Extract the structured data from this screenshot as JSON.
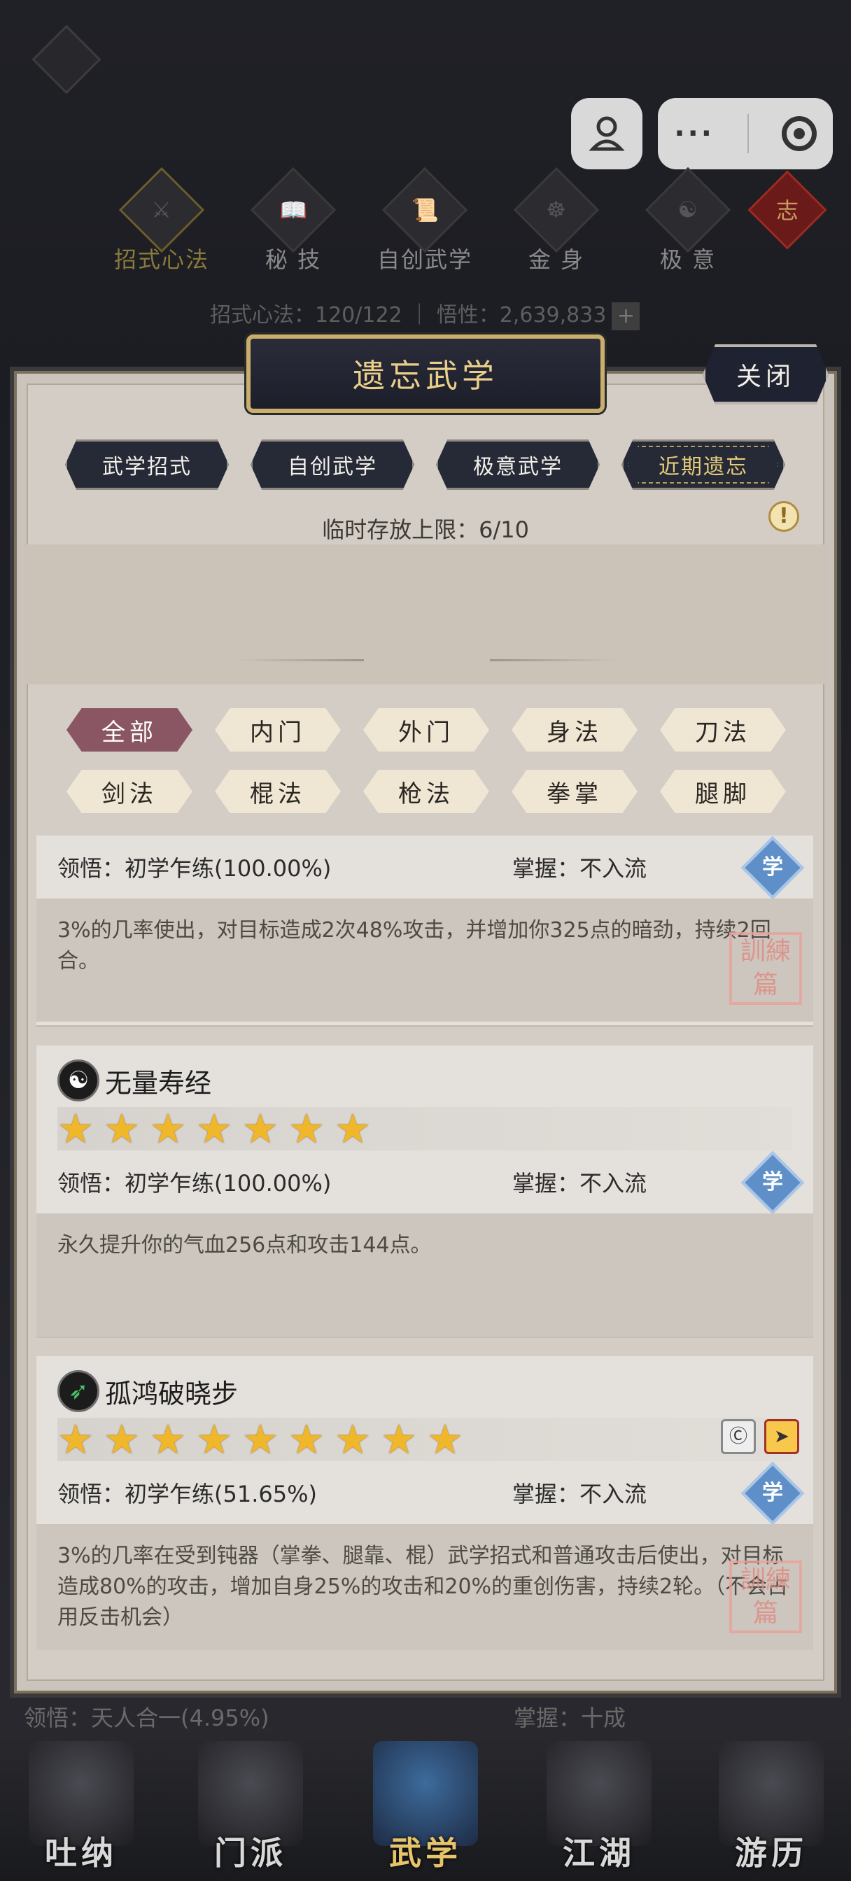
{
  "capsule": {
    "more_label": "···"
  },
  "topnav": {
    "items": [
      {
        "label": "招式心法",
        "icon": "sword-icon"
      },
      {
        "label": "秘 技",
        "icon": "book-icon"
      },
      {
        "label": "自创武学",
        "icon": "scroll-icon"
      },
      {
        "label": "金 身",
        "icon": "meditation-icon"
      },
      {
        "label": "极 意",
        "icon": "martial-pose-icon"
      }
    ],
    "knot_label": "志",
    "stats": "招式心法：120/122 ｜ 悟性：2,639,833"
  },
  "panel": {
    "title": "遗忘武学",
    "close_label": "关闭",
    "tabs": [
      "武学招式",
      "自创武学",
      "极意武学",
      "近期遗忘"
    ],
    "capacity": "临时存放上限：6/10",
    "filters_row1": [
      "全部",
      "内门",
      "外门",
      "身法",
      "刀法"
    ],
    "filters_row2": [
      "剑法",
      "棍法",
      "枪法",
      "拳掌",
      "腿脚"
    ]
  },
  "cards": [
    {
      "name": "",
      "comprehension": "领悟：初学乍练(100.00%)",
      "mastery": "掌握：不入流",
      "learn_badge": "学",
      "desc": "3%的几率使出，对目标造成2次48%攻击，并增加你325点的暗劲，持续2回合。",
      "seal": "訓練篇"
    },
    {
      "name": "无量寿经",
      "icon_glyph": "☯",
      "stars": 7,
      "comprehension": "领悟：初学乍练(100.00%)",
      "mastery": "掌握：不入流",
      "learn_badge": "学",
      "desc": "永久提升你的气血256点和攻击144点。"
    },
    {
      "name": "孤鸿破晓步",
      "icon_glyph": "➶",
      "stars": 9,
      "comprehension": "领悟：初学乍练(51.65%)",
      "mastery": "掌握：不入流",
      "learn_badge": "学",
      "desc": "3%的几率在受到钝器（掌拳、腿靠、棍）武学招式和普通攻击后使出，对目标造成80%的攻击，增加自身25%的攻击和20%的重创伤害，持续2轮。（不会占用反击机会）",
      "seal": "訓練篇"
    }
  ],
  "behind_row": {
    "left": "领悟：天人合一(4.95%)",
    "right": "掌握：十成"
  },
  "bottomnav": {
    "items": [
      "吐纳",
      "门派",
      "武学",
      "江湖",
      "游历"
    ],
    "active": "武学"
  },
  "colors": {
    "accent_gold": "#e6cb7a",
    "filter_active": "#8a5663",
    "star": "#f0b72a"
  }
}
